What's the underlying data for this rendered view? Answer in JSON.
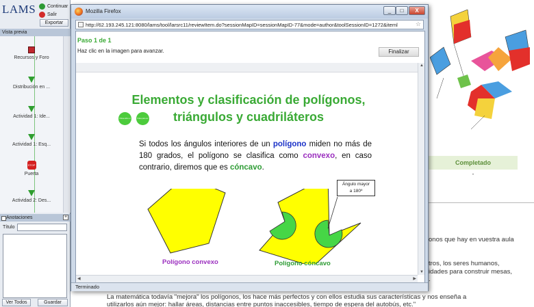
{
  "lams": {
    "logo": "LAMS",
    "continuar": "Continuar",
    "salir": "Salir",
    "exportar": "Exportar",
    "preview_header": "Vista previa",
    "activities": [
      "Recursos y Foro",
      "Distribución en ...",
      "Actividad 1: Ide...",
      "Actividad 1: Esq...",
      "Puerta",
      "Actividad 2: Des..."
    ],
    "stop_label": "STOP",
    "annotations_header": "Anotaciones",
    "annotations_toggle": "+",
    "title_label": "Título",
    "title_value": "",
    "ver_todos": "Ver Todos",
    "guardar": "Guardar"
  },
  "firefox": {
    "title": "Mozilla Firefox",
    "url": "http://62.193.245.121:8080/lams/tool/larsrc11/reviewItem.do?sessionMapID=sessionMapID-77&mode=author&toolSessionID=1272&iteml",
    "status": "Terminado",
    "minimize": "_",
    "maximize": "□",
    "close": "X"
  },
  "lams_item": {
    "step": "Paso 1 de 1",
    "hint": "Haz clic en la imagen para avanzar.",
    "finish_button": "Finalizar"
  },
  "slide": {
    "title_line1": "Elementos y clasificación de polígonos,",
    "title_line2": "triángulos y cuadriláteros",
    "badge1": "Pulsa sobre el título",
    "badge2": "Pulsa para ver",
    "para": {
      "p1": "Si todos los ángulos interiores de un ",
      "k1": "polígono",
      "p2": " miden no más de 180 grados, el polígono se clasifica como ",
      "k2": "convexo",
      "p3": ", en caso contrario, diremos que es ",
      "k3": "cóncavo",
      "p4": "."
    },
    "callout_line1": "Ángulo mayor",
    "callout_line2": "a 180º",
    "label_convex": "Polígono convexo",
    "label_concave": "Polígono cóncavo"
  },
  "background": {
    "table_header": "Completado",
    "table_value": "-",
    "line1": "onos que hay en vuestra aula",
    "line2": "tros, los seres humanos,",
    "line3": "idades para construir mesas,",
    "line4": ".",
    "bottom_line1": "La matemática todavía \"mejora\" los polígonos, los hace más perfectos y con ellos estudia sus características y nos enseña a",
    "bottom_line2": "utilizarlos aún mejor: hallar áreas, distancias entre puntos inaccesibles, tiempo de espera del autobús, etc.\""
  },
  "colors": {
    "lams_green": "#3aaa35",
    "polygon_yellow": "#ffff00",
    "angle_green": "#46d646",
    "keyword_blue": "#1c33c8",
    "keyword_purple": "#9b2fbf"
  }
}
